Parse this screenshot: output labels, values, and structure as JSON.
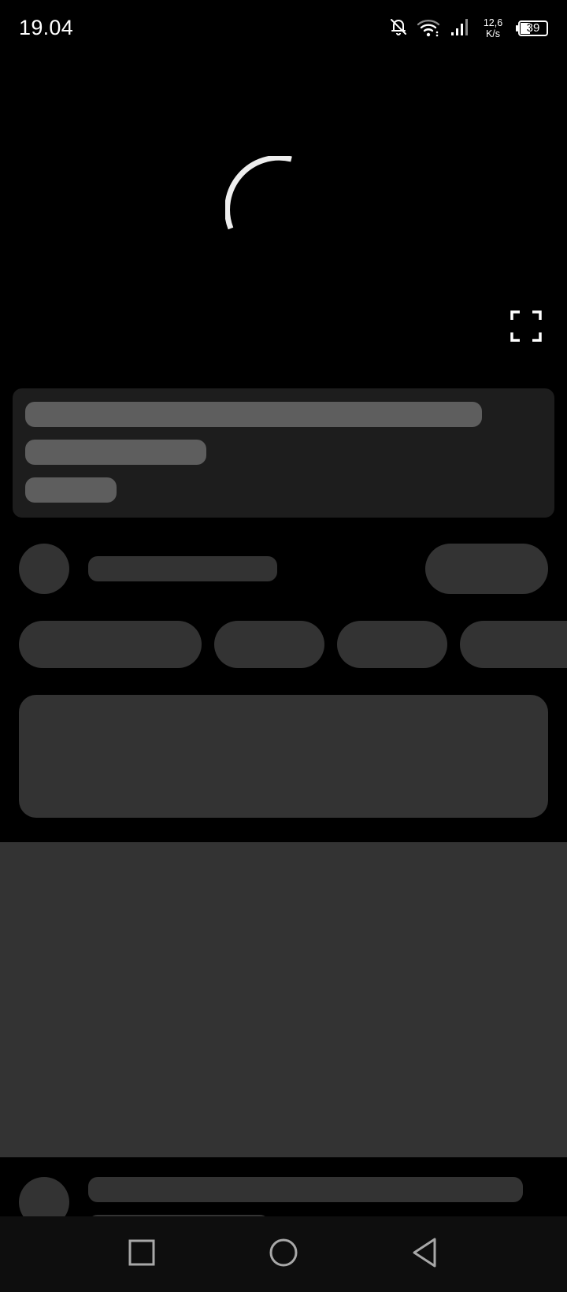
{
  "status_bar": {
    "time": "19.04",
    "net_speed_value": "12,6",
    "net_speed_unit": "K/s",
    "battery_level": "39",
    "battery_fraction": 0.39,
    "icons": [
      "bell-off-icon",
      "wifi-icon",
      "cellular-signal-icon",
      "battery-icon"
    ]
  },
  "video": {
    "loading_icon": "loading-spinner-icon",
    "fullscreen_icon": "fullscreen-icon"
  },
  "colors": {
    "background": "#000000",
    "skeleton_card": "#1d1d1d",
    "skeleton_light": "#5e5e5e",
    "skeleton_dark": "#333333",
    "nav_bar": "#0e0e0e"
  },
  "nav_bar": {
    "icons": [
      "recent-apps-icon",
      "home-icon",
      "back-icon"
    ]
  }
}
